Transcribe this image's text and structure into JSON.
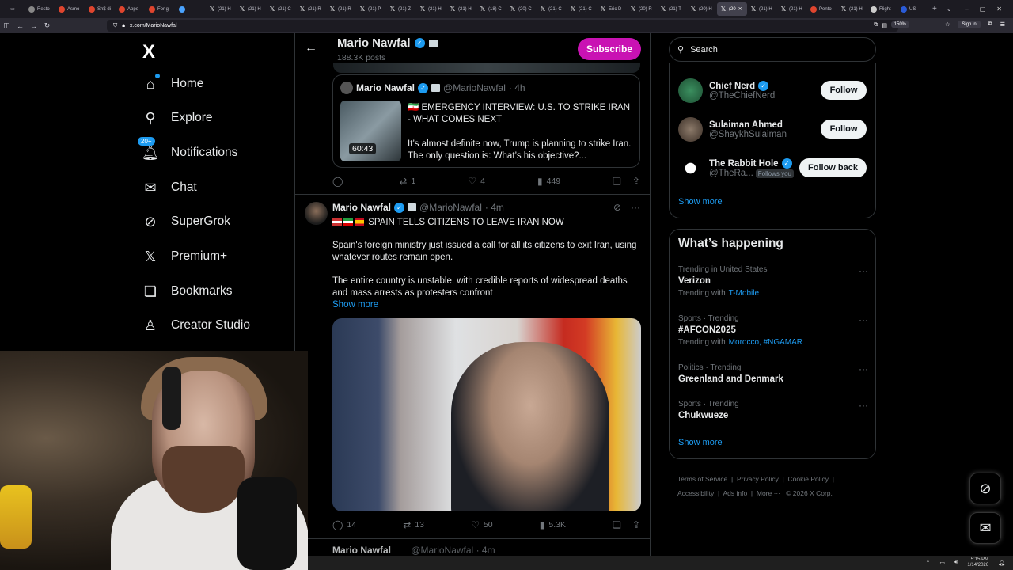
{
  "browser": {
    "tabs": [
      {
        "label": "Resto",
        "fav": "#888"
      },
      {
        "label": "Asmo",
        "fav": "#e0452e"
      },
      {
        "label": "Sh$ di",
        "fav": "#e0452e"
      },
      {
        "label": "Appe",
        "fav": "#e0452e"
      },
      {
        "label": "For gi",
        "fav": "#e0452e"
      },
      {
        "label": "",
        "fav": "#4aa3ff"
      },
      {
        "label": "(21) H",
        "fav": "x"
      },
      {
        "label": "(21) H",
        "fav": "x"
      },
      {
        "label": "(21) C",
        "fav": "x"
      },
      {
        "label": "(21) R",
        "fav": "x"
      },
      {
        "label": "(21) R",
        "fav": "x"
      },
      {
        "label": "(21) P",
        "fav": "x"
      },
      {
        "label": "(21) Z",
        "fav": "x"
      },
      {
        "label": "(21) H",
        "fav": "x"
      },
      {
        "label": "(21) H",
        "fav": "x"
      },
      {
        "label": "(18) C",
        "fav": "x"
      },
      {
        "label": "(20) C",
        "fav": "x"
      },
      {
        "label": "(21) C",
        "fav": "x"
      },
      {
        "label": "(21) C",
        "fav": "x"
      },
      {
        "label": "Eric D",
        "fav": "x"
      },
      {
        "label": "(20) R",
        "fav": "x"
      },
      {
        "label": "(21) T",
        "fav": "x"
      },
      {
        "label": "(20) H",
        "fav": "x"
      },
      {
        "label": "(20",
        "fav": "x",
        "active": true
      },
      {
        "label": "(21) H",
        "fav": "x"
      },
      {
        "label": "(21) H",
        "fav": "x"
      },
      {
        "label": "Pento",
        "fav": "#e0452e"
      },
      {
        "label": "(21) H",
        "fav": "x"
      },
      {
        "label": "Flight",
        "fav": "#ccc"
      },
      {
        "label": "US",
        "fav": "#2a5bd7"
      }
    ],
    "url": "x.com/MarioNawfal",
    "zoom": "150%",
    "signin": "Sign in"
  },
  "sidebar": {
    "logo": "X",
    "items": [
      {
        "label": "Home",
        "icon": "home-icon",
        "glyph": "⌂"
      },
      {
        "label": "Explore",
        "icon": "search-icon",
        "glyph": "⚲"
      },
      {
        "label": "Notifications",
        "icon": "bell-icon",
        "glyph": "🔔︎",
        "badge": "20+"
      },
      {
        "label": "Chat",
        "icon": "mail-icon",
        "glyph": "✉"
      },
      {
        "label": "SuperGrok",
        "icon": "grok-icon",
        "glyph": "⊘"
      },
      {
        "label": "Premium+",
        "icon": "x-premium-icon",
        "glyph": "𝕏"
      },
      {
        "label": "Bookmarks",
        "icon": "bookmark-icon",
        "glyph": "❏"
      },
      {
        "label": "Creator Studio",
        "icon": "creator-studio-icon",
        "glyph": "♙"
      }
    ]
  },
  "header": {
    "name": "Mario Nawfal",
    "posts": "188.3K posts",
    "subscribe": "Subscribe"
  },
  "quote": {
    "name": "Mario Nawfal",
    "handle": "@MarioNawfal",
    "time": "· 4h",
    "duration": "60:43",
    "title": "🇮🇷 EMERGENCY INTERVIEW: U.S. TO STRIKE IRAN - WHAT COMES NEXT",
    "body": "It’s almost definite now, Trump is planning to strike Iran. The only question is: What’s his objective?..."
  },
  "post1_actions": {
    "replies": "",
    "reposts": "1",
    "likes": "4",
    "views": "449"
  },
  "post2": {
    "name": "Mario Nawfal",
    "handle": "@MarioNawfal",
    "time": "· 4m",
    "headline": "SPAIN TELLS CITIZENS TO LEAVE IRAN NOW",
    "para1": "Spain's foreign ministry just issued a call for all its citizens to exit Iran, using whatever routes remain open.",
    "para2": "The entire country is unstable, with credible reports of widespread deaths and mass arrests as protesters confront",
    "show_more": "Show more",
    "actions": {
      "replies": "14",
      "reposts": "13",
      "likes": "50",
      "views": "5.3K"
    }
  },
  "post3": {
    "name": "Mario Nawfal",
    "handle": "@MarioNawfal",
    "time": "· 4m"
  },
  "search": {
    "placeholder": "Search"
  },
  "who_to_follow": {
    "accounts": [
      {
        "name": "Chief Nerd",
        "handle": "@TheChiefNerd",
        "button": "Follow",
        "verified": true,
        "follows_you": ""
      },
      {
        "name": "Sulaiman Ahmed",
        "handle": "@ShaykhSulaiman",
        "button": "Follow",
        "verified": false,
        "follows_you": ""
      },
      {
        "name": "The Rabbit Hole",
        "handle": "@TheRa...",
        "button": "Follow back",
        "verified": true,
        "follows_you": "Follows you"
      }
    ],
    "show_more": "Show more"
  },
  "happening": {
    "title": "What’s happening",
    "trends": [
      {
        "meta": "Trending in United States",
        "name": "Verizon",
        "with_label": "Trending with",
        "with": "T-Mobile"
      },
      {
        "meta": "Sports · Trending",
        "name": "#AFCON2025",
        "with_label": "Trending with",
        "with": "Morocco, #NGAMAR"
      },
      {
        "meta": "Politics · Trending",
        "name": "Greenland and Denmark",
        "with_label": "",
        "with": ""
      },
      {
        "meta": "Sports · Trending",
        "name": "Chukwueze",
        "with_label": "",
        "with": ""
      }
    ],
    "show_more": "Show more"
  },
  "footer": {
    "links": [
      "Terms of Service",
      "Privacy Policy",
      "Cookie Policy",
      "Accessibility",
      "Ads info",
      "More ···"
    ],
    "copyright": "© 2026 X Corp."
  },
  "taskbar": {
    "time": "5:15 PM",
    "date": "1/14/2026"
  }
}
